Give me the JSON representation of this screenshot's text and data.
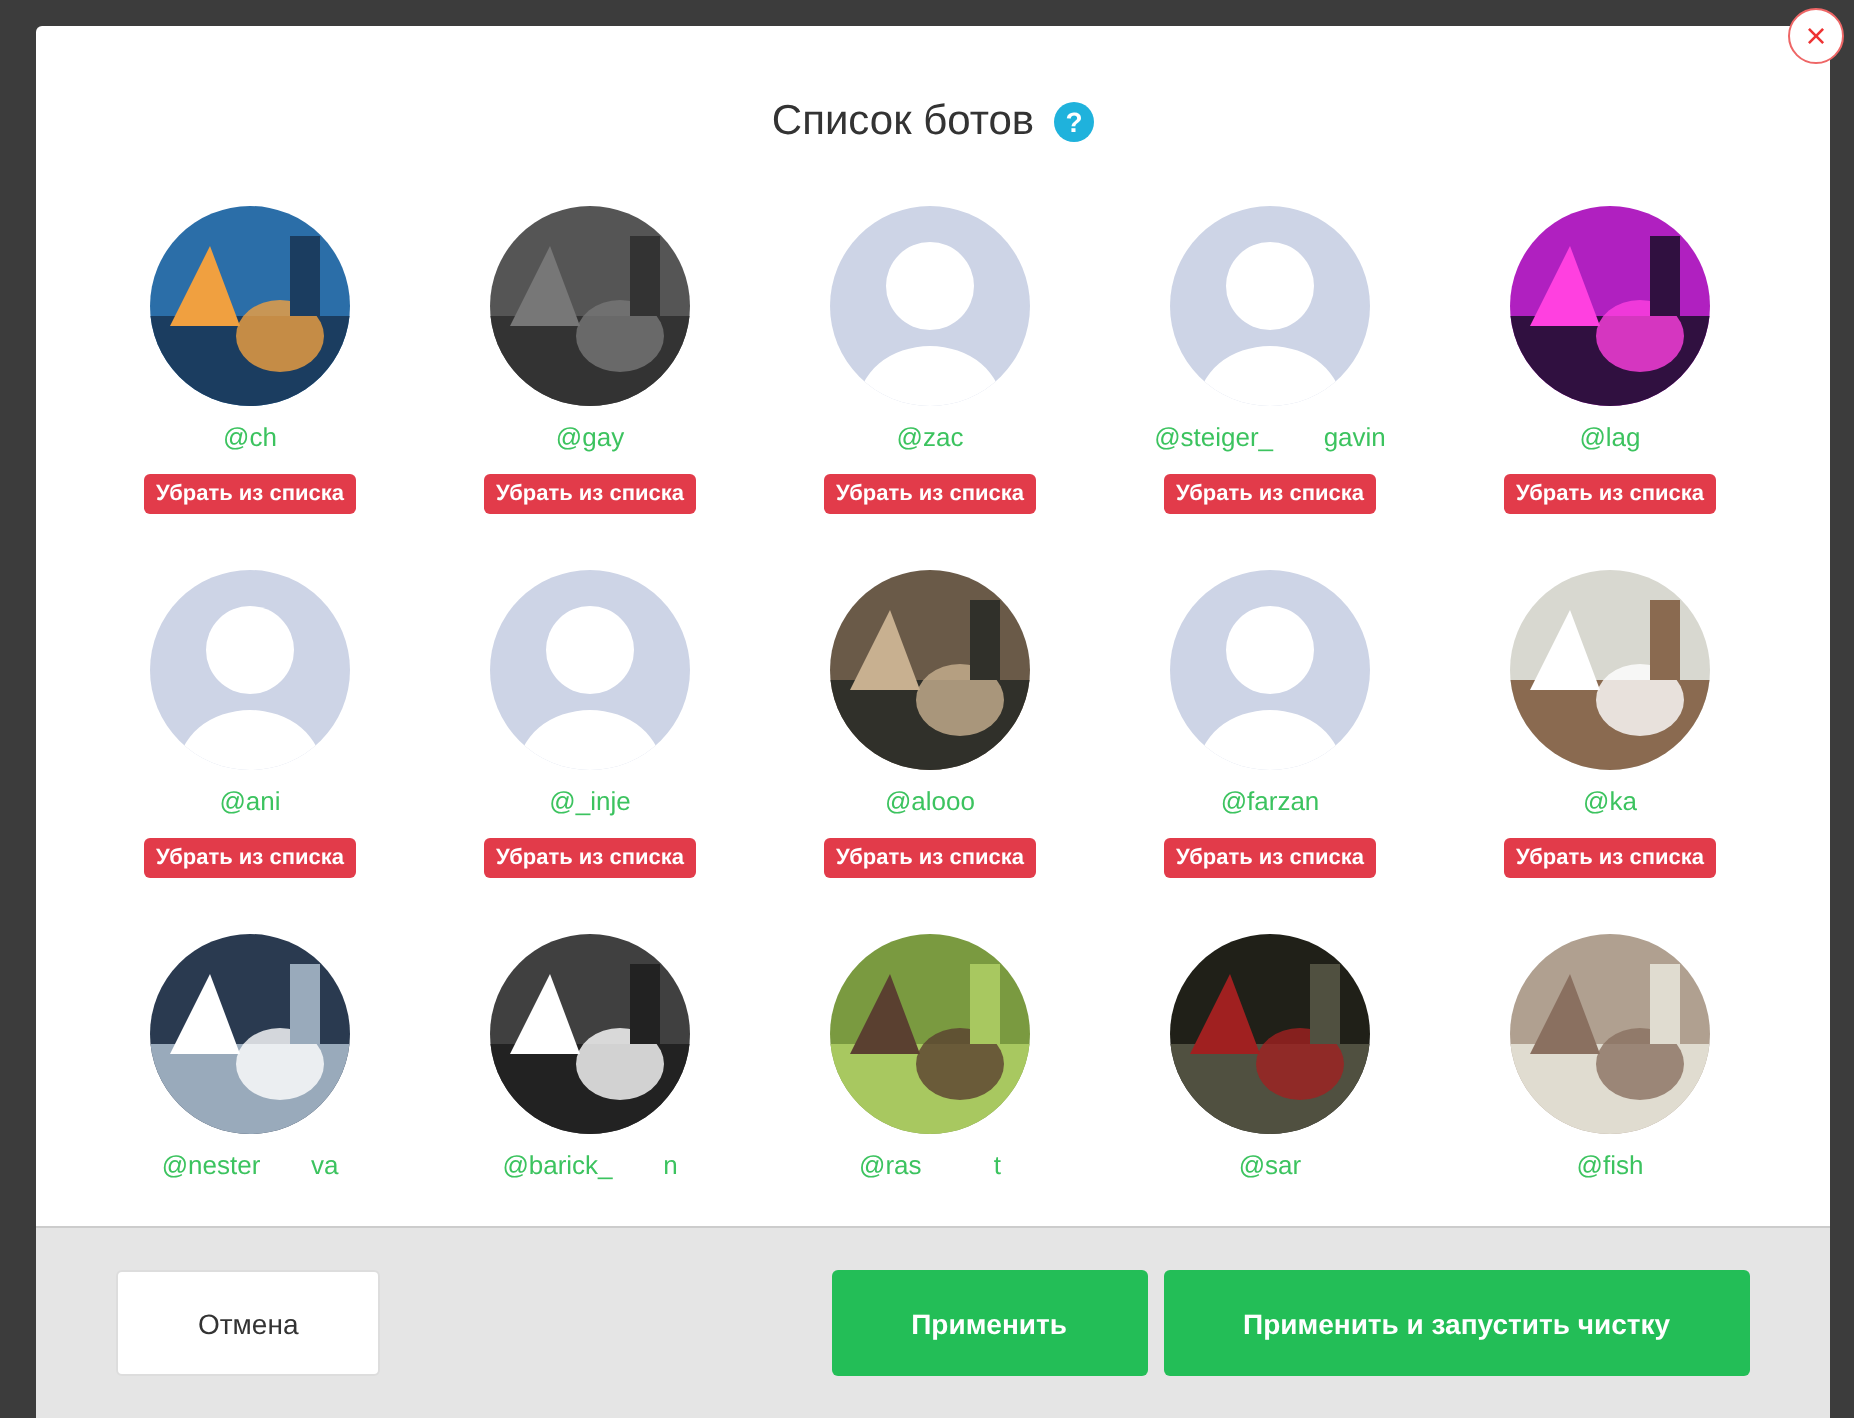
{
  "dialog": {
    "title": "Список ботов",
    "help_icon": "?",
    "close_icon": "×"
  },
  "bots": [
    {
      "username": "@ch",
      "action": "Убрать из списка"
    },
    {
      "username": "@gay",
      "action": "Убрать из списка"
    },
    {
      "username": "@zac",
      "kind": "placeholder",
      "action": "Убрать из списка"
    },
    {
      "username": "@steiger_       gavin",
      "kind": "placeholder",
      "action": "Убрать из списка"
    },
    {
      "username": "@lag",
      "action": "Убрать из списка"
    },
    {
      "username": "@ani",
      "kind": "placeholder",
      "action": "Убрать из списка"
    },
    {
      "username": "@_inje",
      "kind": "placeholder",
      "action": "Убрать из списка"
    },
    {
      "username": "@alooo",
      "action": "Убрать из списка"
    },
    {
      "username": "@farzan",
      "kind": "placeholder",
      "action": "Убрать из списка"
    },
    {
      "username": "@ka",
      "action": "Убрать из списка"
    },
    {
      "username": "@nester       va"
    },
    {
      "username": "@barick_       n"
    },
    {
      "username": "@ras          t"
    },
    {
      "username": "@sar"
    },
    {
      "username": "@fish"
    }
  ],
  "buttons": [
    {
      "label": "Отмена",
      "kind": "secondary"
    },
    {
      "label": "Применить",
      "kind": "primary"
    },
    {
      "label": "Применить и запустить чистку",
      "kind": "primary"
    }
  ]
}
